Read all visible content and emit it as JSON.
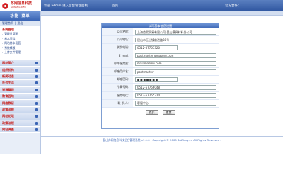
{
  "header": {
    "logo_cn": "苏网信息科技",
    "logo_en": "SUWANG INFO",
    "welcome": "欢迎 admin 进入后台管理面板",
    "home": "首页",
    "official": "官方合作："
  },
  "sidebar": {
    "title_left": "功能",
    "title_right": "菜单",
    "user_manage": "管理首页",
    "logout": "退出",
    "system_title": "系统管理",
    "system_items": [
      "管理员管理",
      "基本资料",
      "网站基本设置",
      "系统模板",
      "上传文件管理"
    ],
    "categories": [
      "网站简介",
      "组织机构",
      "新闻动态",
      "社会生活",
      "资源管理",
      "教育园地",
      "网络教研",
      "政策法规",
      "网站论坛",
      "政策法规",
      "网站调查"
    ]
  },
  "form": {
    "title": "公司基本信息设置",
    "fields": [
      {
        "label": "公司名称：",
        "value": "上海首熙贸易有限公司-昆山模具材料分公司"
      },
      {
        "label": "公司地址：",
        "value": "昆山市玉山镇前进路88号"
      },
      {
        "label": "联系电话：",
        "value": "0512-57765320"
      },
      {
        "label": "E_mail：",
        "value": "postmaster@masmu.com"
      },
      {
        "label": "邮件服务器：",
        "value": "mail.masmu.com"
      },
      {
        "label": "邮箱用户名：",
        "value": "postmaster"
      },
      {
        "label": "邮箱密码：",
        "value": "●●●●●●●"
      },
      {
        "label": "传真号码：",
        "value": "0512-57766048"
      },
      {
        "label": "服务电话：",
        "value": "0512-57765320"
      },
      {
        "label": "联 系 人：",
        "value": "客服中心"
      }
    ],
    "submit": "提交",
    "reset": "重置"
  },
  "footer": "昆山苏网信息科技后台管理系统 v1.1.0 , Copyright © 2005 SuWang.cn All Rights Reserved .",
  "colors": {
    "brand_blue": "#3a64b4",
    "brand_red": "#c8231f"
  }
}
